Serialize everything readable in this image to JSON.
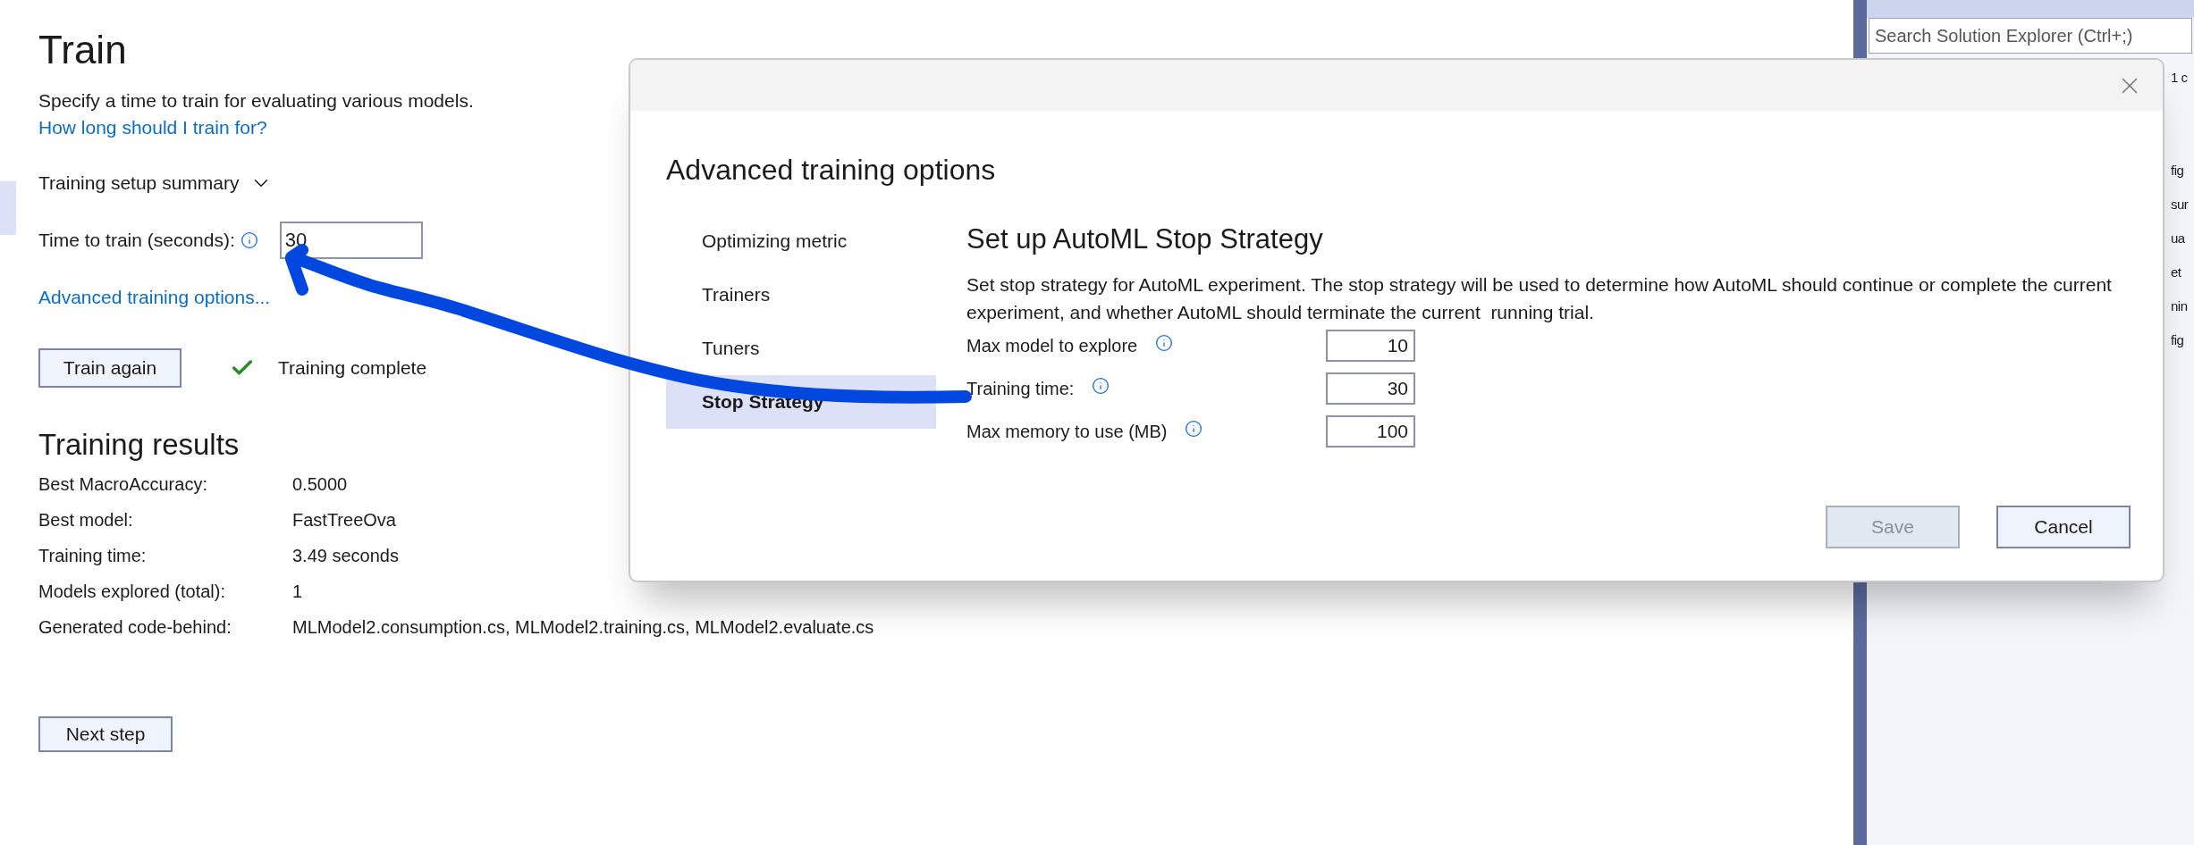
{
  "page": {
    "title": "Train",
    "description": "Specify a time to train for evaluating various models.",
    "help_link": "How long should I train for?",
    "summary_toggle": {
      "label": "Training setup summary",
      "expanded": false
    },
    "time_to_train": {
      "label": "Time to train (seconds):",
      "value": "30"
    },
    "advanced_link": "Advanced training options...",
    "train_button": "Train again",
    "status": "Training complete",
    "results": {
      "title": "Training results",
      "rows": [
        {
          "label": "Best MacroAccuracy:",
          "value": "0.5000"
        },
        {
          "label": "Best model:",
          "value": "FastTreeOva"
        },
        {
          "label": "Training time:",
          "value": "3.49 seconds"
        },
        {
          "label": "Models explored (total):",
          "value": "1"
        },
        {
          "label": "Generated code-behind:",
          "value": "MLModel2.consumption.cs, MLModel2.training.cs, MLModel2.evaluate.cs"
        }
      ]
    },
    "next_button": "Next step"
  },
  "solution_explorer": {
    "search_placeholder": "Search Solution Explorer (Ctrl+;)",
    "items": [
      "1 c",
      "fig",
      "sur",
      "ua",
      "et",
      "nin",
      "fig"
    ]
  },
  "dialog": {
    "title": "Advanced training options",
    "nav": [
      {
        "label": "Optimizing metric",
        "selected": false
      },
      {
        "label": "Trainers",
        "selected": false
      },
      {
        "label": "Tuners",
        "selected": false
      },
      {
        "label": "Stop Strategy",
        "selected": true
      }
    ],
    "heading": "Set up AutoML Stop Strategy",
    "description": "Set stop strategy for AutoML experiment. The stop strategy will be used to determine how AutoML should continue or complete the current experiment, and whether AutoML should terminate the current  running trial.",
    "fields": [
      {
        "label": "Max model to explore",
        "value": "10"
      },
      {
        "label": "Training time:",
        "value": "30"
      },
      {
        "label": "Max memory to use (MB)",
        "value": "100"
      }
    ],
    "buttons": [
      {
        "label": "Save",
        "disabled": true
      },
      {
        "label": "Cancel",
        "disabled": false
      }
    ]
  }
}
